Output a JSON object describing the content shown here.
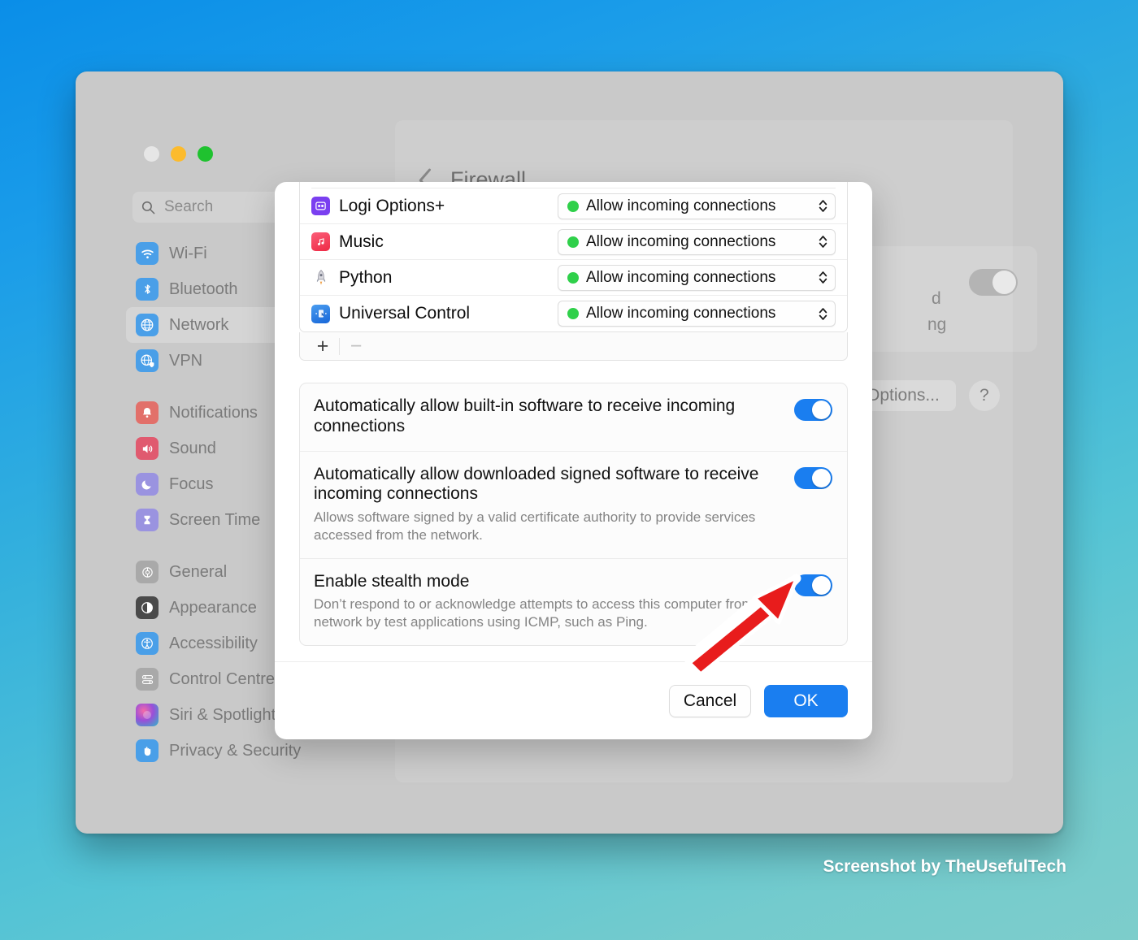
{
  "window": {
    "traffic_lights": [
      "close",
      "minimize",
      "zoom"
    ],
    "search": {
      "placeholder": "Search",
      "icon": "search-icon"
    }
  },
  "sidebar": {
    "groups": [
      {
        "items": [
          {
            "label": "Wi-Fi",
            "icon": "wifi-icon",
            "color": "#4a9fe8",
            "glyph": "●",
            "selected": false
          },
          {
            "label": "Bluetooth",
            "icon": "bluetooth-icon",
            "color": "#4a9fe8",
            "glyph": "ᛦ",
            "selected": false
          },
          {
            "label": "Network",
            "icon": "globe-icon",
            "color": "#4a9fe8",
            "glyph": "ἱ0",
            "selected": true
          },
          {
            "label": "VPN",
            "icon": "vpn-globe-icon",
            "color": "#4a9fe8",
            "glyph": "ἱ0",
            "selected": false
          }
        ]
      },
      {
        "items": [
          {
            "label": "Notifications",
            "icon": "bell-icon",
            "color": "#e2706a",
            "glyph": "ὑ4",
            "selected": false
          },
          {
            "label": "Sound",
            "icon": "speaker-icon",
            "color": "#e05a6f",
            "glyph": "ὐA",
            "selected": false
          },
          {
            "label": "Focus",
            "icon": "moon-icon",
            "color": "#9a93e0",
            "glyph": "☽",
            "selected": false
          },
          {
            "label": "Screen Time",
            "icon": "hourglass-icon",
            "color": "#9a93e0",
            "glyph": "⌛",
            "selected": false
          }
        ]
      },
      {
        "items": [
          {
            "label": "General",
            "icon": "gear-icon",
            "color": "#a9a9a9",
            "glyph": "⚙",
            "selected": false
          },
          {
            "label": "Appearance",
            "icon": "appearance-icon",
            "color": "#4a4a4a",
            "glyph": "◑",
            "selected": false
          },
          {
            "label": "Accessibility",
            "icon": "accessibility-icon",
            "color": "#4a9fe8",
            "glyph": "♿",
            "selected": false
          },
          {
            "label": "Control Centre",
            "icon": "control-centre-icon",
            "color": "#a9a9a9",
            "glyph": "☰",
            "selected": false
          },
          {
            "label": "Siri & Spotlight",
            "icon": "siri-icon",
            "color": "#8a4fa8",
            "glyph": "●",
            "selected": false
          },
          {
            "label": "Privacy & Security",
            "icon": "hand-icon",
            "color": "#4a9fe8",
            "glyph": "✋",
            "selected": false
          }
        ]
      }
    ]
  },
  "detail": {
    "back_label": "back-chevron",
    "title": "Firewall",
    "background_fragments": [
      "d",
      "ng"
    ],
    "firewall_toggle_state": "off",
    "options_button": "Options...",
    "help_button": "?"
  },
  "modal": {
    "app_list": [
      {
        "name": "Logi Options+",
        "icon": "logi-options-icon",
        "icon_color": "#7a3ff0",
        "glyph": "⌗",
        "permission": "Allow incoming connections",
        "status_color": "#2fd04a"
      },
      {
        "name": "Music",
        "icon": "music-icon",
        "icon_color": "#f03a52",
        "glyph": "♫",
        "permission": "Allow incoming connections",
        "status_color": "#2fd04a"
      },
      {
        "name": "Python",
        "icon": "python-rocket-icon",
        "icon_color": "#b8b8c0",
        "glyph": "Ὠ0",
        "permission": "Allow incoming connections",
        "status_color": "#2fd04a"
      },
      {
        "name": "Universal Control",
        "icon": "universal-control-icon",
        "icon_color": "#2a7fe8",
        "glyph": "↔",
        "permission": "Allow incoming connections",
        "status_color": "#2fd04a"
      }
    ],
    "list_controls": {
      "add": "+",
      "remove": "−"
    },
    "settings": [
      {
        "title": "Automatically allow built-in software to receive incoming connections",
        "description": "",
        "toggle": "on"
      },
      {
        "title": "Automatically allow downloaded signed software to receive incoming connections",
        "description": "Allows software signed by a valid certificate authority to provide services accessed from the network.",
        "toggle": "on"
      },
      {
        "title": "Enable stealth mode",
        "description": "Don’t respond to or acknowledge attempts to access this computer from the network by test applications using ICMP, such as Ping.",
        "toggle": "on"
      }
    ],
    "footer": {
      "cancel": "Cancel",
      "ok": "OK"
    }
  },
  "annotation": {
    "arrow": "red-arrow-pointing-to-stealth-toggle",
    "color": "#e81c1c"
  },
  "watermark": "Screenshot by TheUsefulTech",
  "colors": {
    "accent_blue": "#1a7ef0",
    "status_green": "#2fd04a",
    "annotation_red": "#e81c1c",
    "window_grey": "#c9c9c9"
  }
}
